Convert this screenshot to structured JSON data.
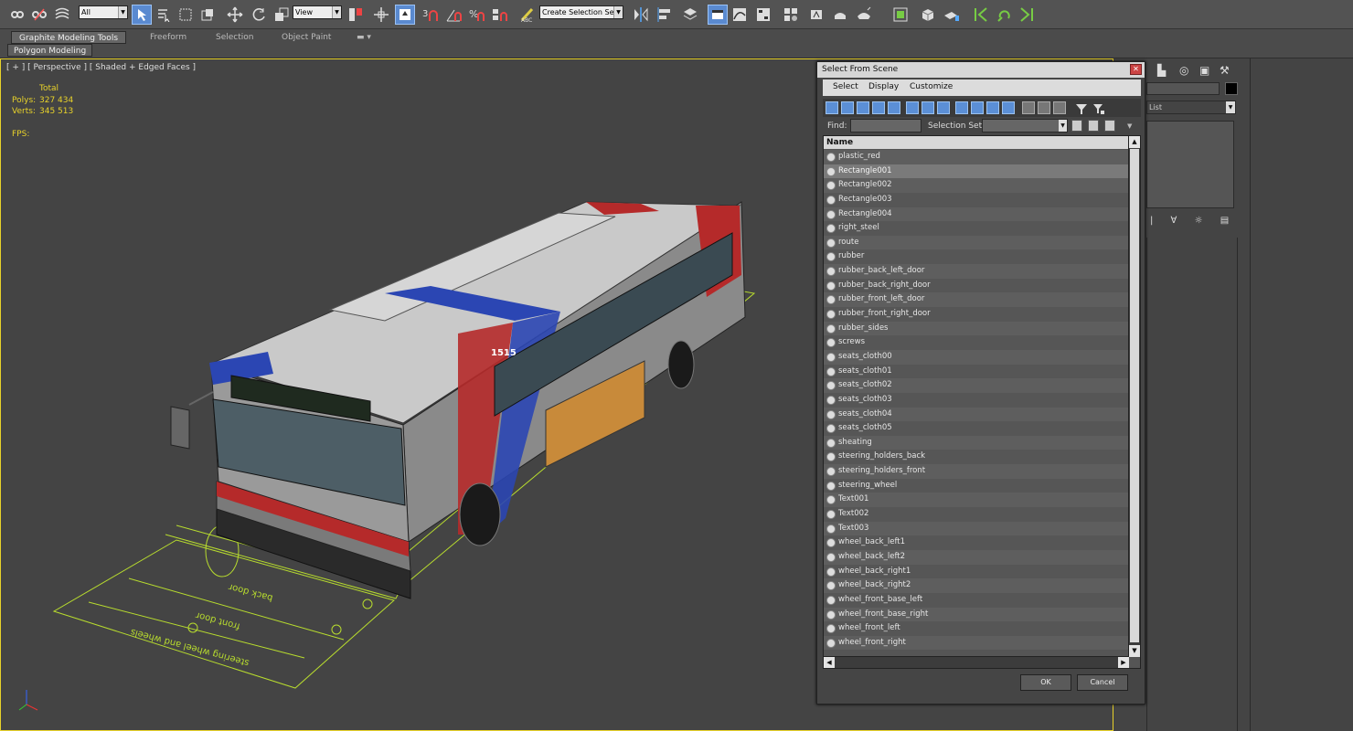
{
  "toolbar": {
    "filter_value": "All",
    "ref_coord_value": "View",
    "selection_set_placeholder": "Create Selection Se",
    "percent_snap_label": "%"
  },
  "ribbon": {
    "tabs": [
      {
        "label": "Graphite Modeling Tools"
      },
      {
        "label": "Freeform"
      },
      {
        "label": "Selection"
      },
      {
        "label": "Object Paint"
      }
    ],
    "sub_tab": "Polygon Modeling"
  },
  "viewport": {
    "label": "[ + ] [ Perspective ] [ Shaded + Edged Faces ]",
    "stats": {
      "total_label": "Total",
      "polys_label": "Polys:",
      "polys_value": "327 434",
      "verts_label": "Verts:",
      "verts_value": "345 513",
      "fps_label": "FPS:"
    },
    "bus_number": "1515",
    "ground_labels": [
      "back door",
      "front door",
      "steering wheel and wheels"
    ]
  },
  "command_panel": {
    "modifier_list_label": "List"
  },
  "dialog": {
    "title": "Select From Scene",
    "menu": [
      "Select",
      "Display",
      "Customize"
    ],
    "find_label": "Find:",
    "selection_set_label": "Selection Set:",
    "column_header": "Name",
    "items": [
      "plastic_red",
      "Rectangle001",
      "Rectangle002",
      "Rectangle003",
      "Rectangle004",
      "right_steel",
      "route",
      "rubber",
      "rubber_back_left_door",
      "rubber_back_right_door",
      "rubber_front_left_door",
      "rubber_front_right_door",
      "rubber_sides",
      "screws",
      "seats_cloth00",
      "seats_cloth01",
      "seats_cloth02",
      "seats_cloth03",
      "seats_cloth04",
      "seats_cloth05",
      "sheating",
      "steering_holders_back",
      "steering_holders_front",
      "steering_wheel",
      "Text001",
      "Text002",
      "Text003",
      "wheel_back_left1",
      "wheel_back_left2",
      "wheel_back_right1",
      "wheel_back_right2",
      "wheel_front_base_left",
      "wheel_front_base_right",
      "wheel_front_left",
      "wheel_front_right"
    ],
    "selected_item": "Rectangle001",
    "ok_label": "OK",
    "cancel_label": "Cancel"
  },
  "colors": {
    "viewport_border": "#e8d22a",
    "stats_text": "#e8d22a",
    "bus_red": "#b52a2a",
    "bus_blue": "#2b46b3",
    "active_tool": "#5a8ad0"
  }
}
